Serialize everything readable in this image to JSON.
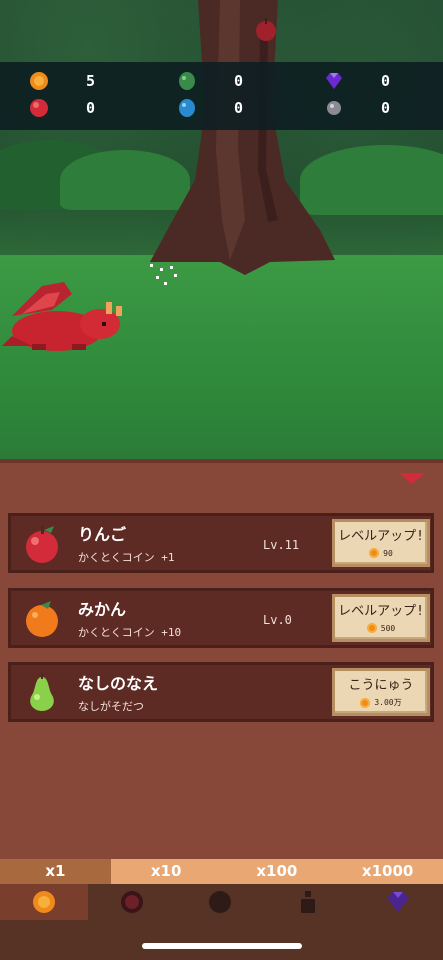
{
  "resources": {
    "coin": "5",
    "red_gem": "0",
    "green_egg": "0",
    "blue_egg": "0",
    "purple_gem": "0",
    "silver_orb": "0"
  },
  "items": [
    {
      "name": "りんご",
      "desc": "かくとくコイン +1",
      "level": "Lv.11",
      "button": "レベルアップ!",
      "cost": "90"
    },
    {
      "name": "みかん",
      "desc": "かくとくコイン +10",
      "level": "Lv.0",
      "button": "レベルアップ!",
      "cost": "500"
    },
    {
      "name": "なしのなえ",
      "desc": "なしがそだつ",
      "level": "",
      "button": "こうにゅう",
      "cost": "3.00万"
    }
  ],
  "multipliers": [
    "x1",
    "x10",
    "x100",
    "x1000"
  ],
  "active_multiplier": "x1",
  "nav_icons": [
    "coin-icon",
    "red-orb-icon",
    "dark-orb-icon",
    "bottle-icon",
    "gem-icon"
  ],
  "colors": {
    "panel": "#87483a",
    "item": "#5d2a24",
    "button": "#ecd7b5",
    "active_mult": "#a8693f",
    "nav": "#563325"
  }
}
